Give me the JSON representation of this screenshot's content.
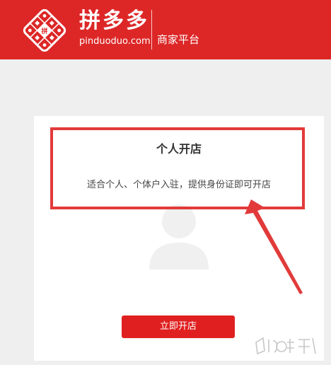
{
  "header": {
    "brand_name": "拼多多",
    "brand_domain": "pinduoduo.com",
    "platform_label": "商家平台",
    "logo_icon": "pinduoduo-logo-icon",
    "brand_color": "#dd2727"
  },
  "card": {
    "title": "个人开店",
    "description": "适合个人、个体户入驻，提供身份证即可开店",
    "avatar_icon": "user-avatar-icon",
    "button_label": "立即开店",
    "button_color": "#e02020"
  },
  "annotation": {
    "highlight_color": "#e23a3a",
    "arrow_icon": "red-arrow-icon"
  }
}
